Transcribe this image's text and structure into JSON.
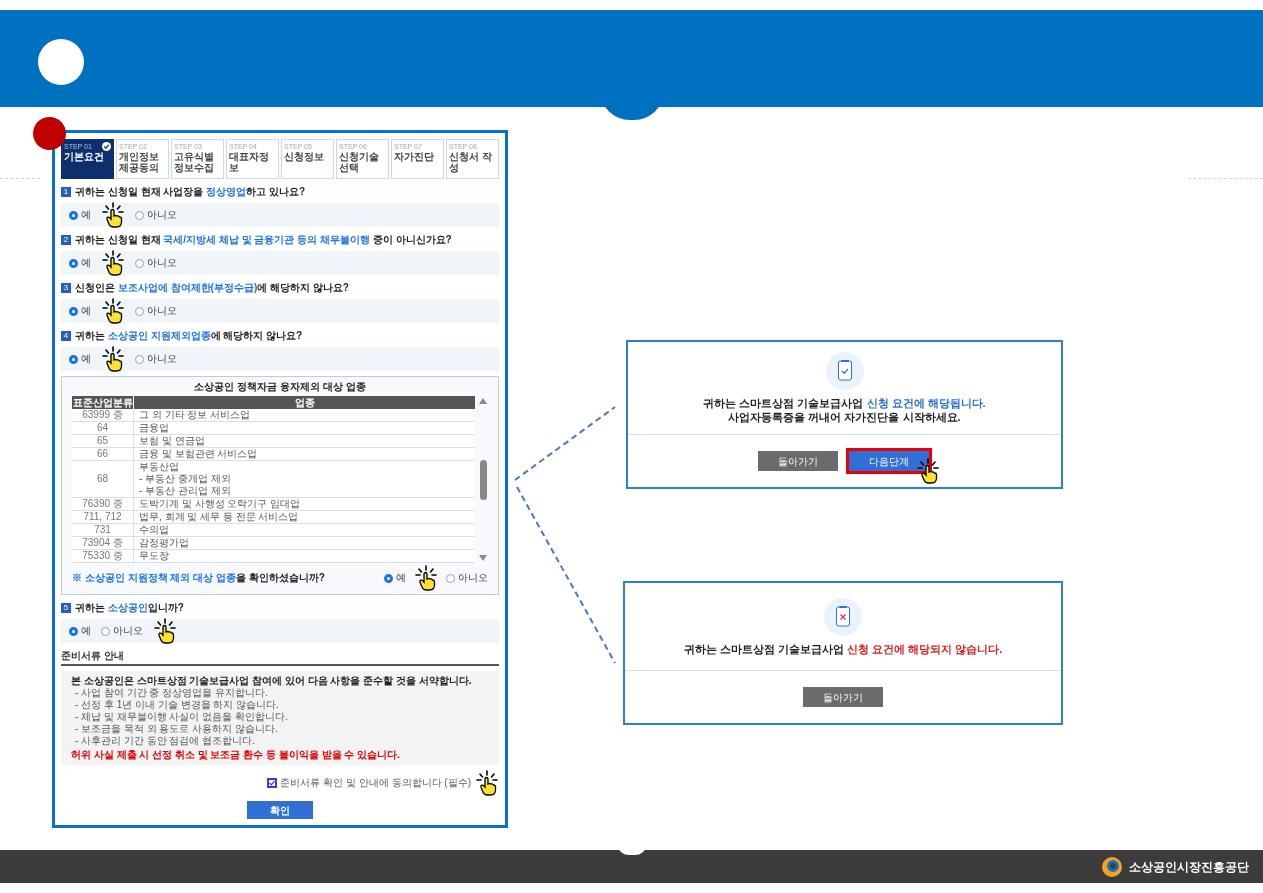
{
  "steps": [
    {
      "number": "STEP 01",
      "label": "기본요건",
      "selected": true,
      "done": true
    },
    {
      "number": "STEP 02",
      "label": "개인정보 제공동의",
      "selected": false,
      "done": false
    },
    {
      "number": "STEP 03",
      "label": "고유식별 정보수집",
      "selected": false,
      "done": false
    },
    {
      "number": "STEP 04",
      "label": "대표자정보",
      "selected": false,
      "done": false
    },
    {
      "number": "STEP 05",
      "label": "신청정보",
      "selected": false,
      "done": false
    },
    {
      "number": "STEP 06",
      "label": "신청기술 선택",
      "selected": false,
      "done": false
    },
    {
      "number": "STEP 07",
      "label": "자가진단",
      "selected": false,
      "done": false
    },
    {
      "number": "STEP 08",
      "label": "신청서 작성",
      "selected": false,
      "done": false
    }
  ],
  "sections": [
    {
      "kind": "question",
      "number": "1",
      "segments": [
        {
          "text": "귀하는 신청일 현재 사업장을 ",
          "highlight": false
        },
        {
          "text": "정상영업",
          "highlight": true
        },
        {
          "text": "하고 있나요?",
          "highlight": false
        }
      ],
      "options": [
        {
          "label": "예",
          "selected": true,
          "pointer": true
        },
        {
          "label": "아니오",
          "selected": false,
          "pointer": false
        }
      ]
    },
    {
      "kind": "question",
      "number": "2",
      "segments": [
        {
          "text": "귀하는 신청일 현재 ",
          "highlight": false
        },
        {
          "text": "국세/지방세 체납 및 금융기관 등의 채무불이행",
          "highlight": true
        },
        {
          "text": " 중이 아니신가요?",
          "highlight": false
        }
      ],
      "options": [
        {
          "label": "예",
          "selected": true,
          "pointer": true
        },
        {
          "label": "아니오",
          "selected": false,
          "pointer": false
        }
      ]
    },
    {
      "kind": "question",
      "number": "3",
      "segments": [
        {
          "text": "신청인은 ",
          "highlight": false
        },
        {
          "text": "보조사업에 참여제한(부정수급)",
          "highlight": true
        },
        {
          "text": "에 해당하지 않나요?",
          "highlight": false
        }
      ],
      "options": [
        {
          "label": "예",
          "selected": true,
          "pointer": true
        },
        {
          "label": "아니오",
          "selected": false,
          "pointer": false
        }
      ]
    },
    {
      "kind": "question",
      "number": "4",
      "segments": [
        {
          "text": "귀하는 ",
          "highlight": false
        },
        {
          "text": "소상공인 지원제외업종",
          "highlight": true
        },
        {
          "text": "에 해당하지 않나요?",
          "highlight": false
        }
      ],
      "options": [
        {
          "label": "예",
          "selected": true,
          "pointer": true
        },
        {
          "label": "아니오",
          "selected": false,
          "pointer": false
        }
      ]
    },
    {
      "kind": "table",
      "title": "소상공인 정책자금 융자제외 대상 업종",
      "columns": [
        "표준산업분류",
        "업종"
      ],
      "rows": [
        {
          "code": "63999 중",
          "lines": [
            "그 외 기타 정보 서비스업"
          ]
        },
        {
          "code": "64",
          "lines": [
            "금융업"
          ]
        },
        {
          "code": "65",
          "lines": [
            "보험 및 연금업"
          ]
        },
        {
          "code": "66",
          "lines": [
            "금융 및 보험관련 서비스업"
          ]
        },
        {
          "code": "68",
          "lines": [
            "부동산업",
            "- 부동산 중개업 제외",
            "- 부동산 관리업 제외"
          ]
        },
        {
          "code": "76390 중",
          "lines": [
            "도박기계 및 사행성 오락기구 임대업"
          ]
        },
        {
          "code": "711, 712",
          "lines": [
            "법무, 회계 및 세무 등 전문 서비스업"
          ]
        },
        {
          "code": "731",
          "lines": [
            "수의업"
          ]
        },
        {
          "code": "73904 중",
          "lines": [
            "감정평가업"
          ]
        },
        {
          "code": "75330 중",
          "lines": [
            "무도장"
          ]
        }
      ],
      "segments": [
        {
          "text": "※ 소상공인 지원정책 제외 대상 업종",
          "highlight": true
        },
        {
          "text": "을 확인하셨습니까?",
          "highlight": false
        }
      ],
      "options": [
        {
          "label": "예",
          "selected": true,
          "pointer": true
        },
        {
          "label": "아니오",
          "selected": false,
          "pointer": false
        }
      ]
    },
    {
      "kind": "question",
      "number": "5",
      "segments": [
        {
          "text": "귀하는 ",
          "highlight": false
        },
        {
          "text": "소상공인",
          "highlight": true
        },
        {
          "text": "입니까?",
          "highlight": false
        }
      ],
      "options": [
        {
          "label": "예",
          "selected": true,
          "pointer": false
        },
        {
          "label": "아니오",
          "selected": false,
          "pointer": true
        }
      ]
    }
  ],
  "agreement": {
    "title": "준비서류 안내",
    "heading": "본 소상공인은 스마트상점 기술보급사업 참여에 있어 다음 사항을 준수할 것을 서약합니다.",
    "items": [
      "- 사업 참여 기간 중 정상영업을 유지합니다.",
      "- 선정 후 1년 이내 기술 변경을 하지 않습니다.",
      "- 체납 및 채무불이행 사실이 없음을 확인합니다.",
      "- 보조금을 목적 외 용도로 사용하지 않습니다.",
      "- 사후관리 기간 동안 점검에 협조합니다."
    ],
    "warning": "허위 사실 제출 시 선정 취소 및 보조금 환수 등 불이익을 받을 수 있습니다.",
    "consent": {
      "label": "준비서류 확인 및 안내에 동의합니다 (필수)",
      "checked": true,
      "pointer": true
    },
    "button": "확인"
  },
  "dialogs": [
    {
      "kind": "eligible",
      "segments": [
        {
          "text": "귀하는 스마트상점 기술보급사업 ",
          "highlight": false
        },
        {
          "text": "신청 요건에 해당됩니다.",
          "highlight": true
        }
      ],
      "second_line": "사업자등록증을 꺼내어 자가진단을 시작하세요.",
      "buttons": [
        {
          "label": "돌아가기",
          "kind": "secondary",
          "highlighted": false,
          "pointer": false
        },
        {
          "label": "다음단계",
          "kind": "primary",
          "highlighted": true,
          "pointer": true
        }
      ]
    },
    {
      "kind": "ineligible",
      "segments": [
        {
          "text": "귀하는 스마트상점 기술보급사업 ",
          "highlight": false
        },
        {
          "text": "신청 요건에 해당되지 않습니다.",
          "highlight": true
        }
      ],
      "buttons": [
        {
          "label": "돌아가기",
          "kind": "secondary",
          "highlighted": false,
          "pointer": false
        }
      ]
    }
  ],
  "footer": {
    "organization": "소상공인시장진흥공단"
  }
}
